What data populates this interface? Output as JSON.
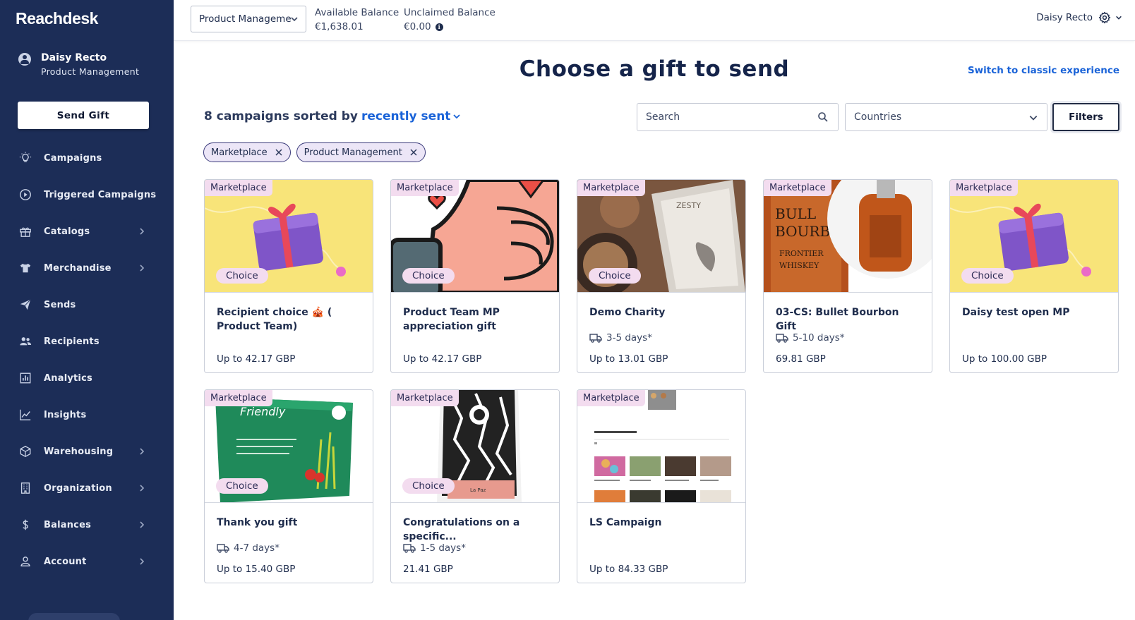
{
  "app": {
    "logo": "Reachdesk"
  },
  "sidebar": {
    "user_name": "Daisy Recto",
    "user_org": "Product Management",
    "send_gift_label": "Send Gift",
    "items": [
      {
        "label": "Campaigns",
        "icon": "lightbulb-icon",
        "has_chevron": false
      },
      {
        "label": "Triggered Campaigns",
        "icon": "play-circle-icon",
        "has_chevron": false
      },
      {
        "label": "Catalogs",
        "icon": "gift-box-icon",
        "has_chevron": true
      },
      {
        "label": "Merchandise",
        "icon": "tshirt-icon",
        "has_chevron": true
      },
      {
        "label": "Sends",
        "icon": "paper-plane-icon",
        "has_chevron": false
      },
      {
        "label": "Recipients",
        "icon": "people-icon",
        "has_chevron": false
      },
      {
        "label": "Analytics",
        "icon": "bar-chart-icon",
        "has_chevron": false
      },
      {
        "label": "Insights",
        "icon": "line-chart-icon",
        "has_chevron": false
      },
      {
        "label": "Warehousing",
        "icon": "package-icon",
        "has_chevron": true
      },
      {
        "label": "Organization",
        "icon": "building-icon",
        "has_chevron": true
      },
      {
        "label": "Balances",
        "icon": "dollar-icon",
        "has_chevron": true
      },
      {
        "label": "Account",
        "icon": "person-icon",
        "has_chevron": true
      }
    ]
  },
  "topbar": {
    "org_select_value": "Product Manageme",
    "available_label": "Available Balance",
    "available_value": "€1,638.01",
    "unclaimed_label": "Unclaimed Balance",
    "unclaimed_value": "€0.00",
    "user_name": "Daisy Recto"
  },
  "main": {
    "title": "Choose a gift to send",
    "classic_link": "Switch to classic experience",
    "sort_prefix": "8 campaigns sorted by",
    "sort_value": "recently sent",
    "search_placeholder": "Search",
    "countries_placeholder": "Countries",
    "filters_label": "Filters",
    "chips": [
      "Marketplace",
      "Product Management"
    ],
    "cards": [
      {
        "tag": "Marketplace",
        "choice": "Choice",
        "title": "Recipient choice 🎪 ( Product Team)",
        "shipping": "",
        "price_prefix": "Up to",
        "price": "42.17 GBP",
        "image": "gift-box"
      },
      {
        "tag": "Marketplace",
        "choice": "Choice",
        "title": "Product Team MP appreciation gift",
        "shipping": "",
        "price_prefix": "Up to",
        "price": "42.17 GBP",
        "image": "thumbs-up"
      },
      {
        "tag": "Marketplace",
        "choice": "Choice",
        "title": "Demo Charity",
        "shipping": "3-5 days*",
        "price_prefix": "Up to",
        "price": "13.01 GBP",
        "image": "granola-bag"
      },
      {
        "tag": "Marketplace",
        "choice": "",
        "title": "03-CS: Bullet Bourbon Gift",
        "shipping": "5-10 days*",
        "price_prefix": "",
        "price": "69.81 GBP",
        "image": "bourbon"
      },
      {
        "tag": "Marketplace",
        "choice": "Choice",
        "title": "Daisy test open MP",
        "shipping": "",
        "price_prefix": "Up to",
        "price": "100.00 GBP",
        "image": "gift-box"
      },
      {
        "tag": "Marketplace",
        "choice": "Choice",
        "title": "Thank you gift",
        "shipping": "4-7 days*",
        "price_prefix": "Up to",
        "price": "15.40 GBP",
        "image": "green-box"
      },
      {
        "tag": "Marketplace",
        "choice": "Choice",
        "title": "Congratulations on a specific...",
        "shipping": "1-5 days*",
        "price_prefix": "",
        "price": "21.41 GBP",
        "image": "coffee-bag"
      },
      {
        "tag": "Marketplace",
        "choice": "",
        "title": "LS Campaign",
        "shipping": "",
        "price_prefix": "Up to",
        "price": "84.33 GBP",
        "image": "web-screenshot"
      }
    ]
  }
}
